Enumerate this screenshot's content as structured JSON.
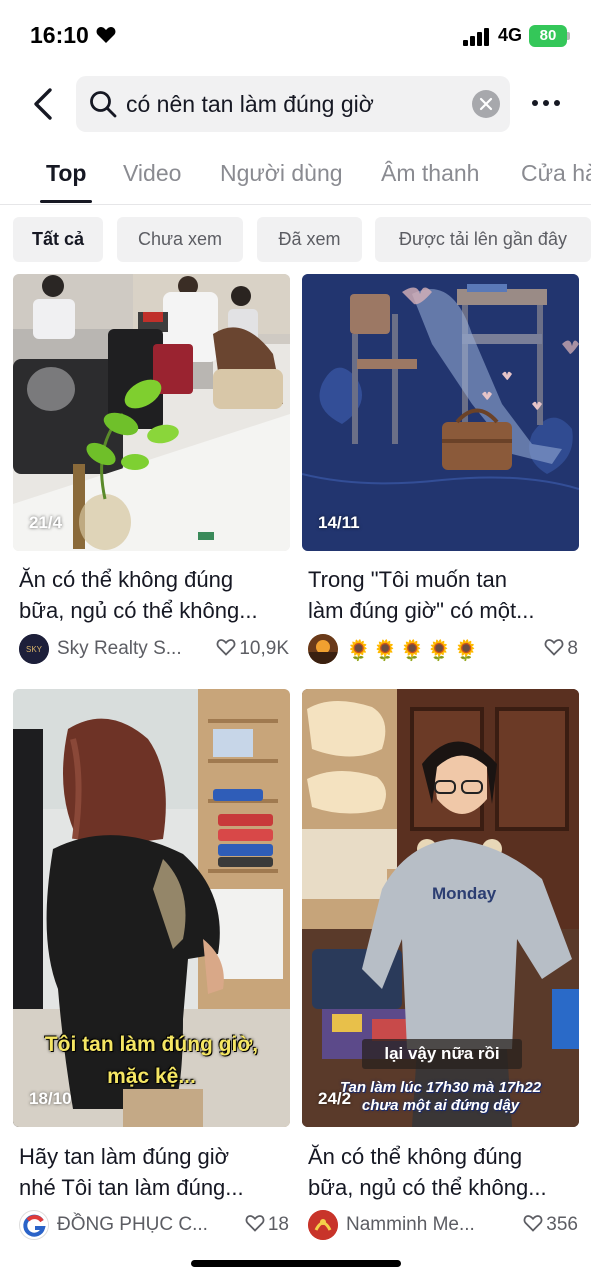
{
  "status": {
    "time": "16:10",
    "network": "4G",
    "battery": "80"
  },
  "search": {
    "query": "có nên tan làm đúng giờ"
  },
  "tabs": [
    "Top",
    "Video",
    "Người dùng",
    "Âm thanh",
    "Cửa hà"
  ],
  "filters": [
    "Tất cả",
    "Chưa xem",
    "Đã xem",
    "Được tải lên gần đây"
  ],
  "results": [
    {
      "date": "21/4",
      "caption_line1": "Ăn có thể không đúng",
      "caption_line2": "bữa, ngủ có thể không...",
      "author": "Sky Realty S...",
      "likes": "10,9K",
      "avatar_label": "SKY"
    },
    {
      "date": "14/11",
      "caption_line1": "Trong \"Tôi muốn tan",
      "caption_line2": "làm đúng giờ\" có một...",
      "author": "🌻🌻🌻🌻🌻",
      "likes": "8"
    },
    {
      "date": "18/10",
      "caption_line1": "Hãy tan làm đúng giờ",
      "caption_line2": "nhé Tôi tan làm đúng...",
      "author": "ĐỒNG PHỤC C...",
      "likes": "18",
      "overlay_line1": "Tôi tan làm đúng giờ,",
      "overlay_line2": "mặc kệ..."
    },
    {
      "date": "24/2",
      "caption_line1": "Ăn có thể không đúng",
      "caption_line2": "bữa, ngủ có thể không...",
      "author": "Namminh Me...",
      "likes": "356",
      "overlay_line1": "lại vậy nữa rồi",
      "overlay_line2": "Tan làm lúc 17h30 mà 17h22",
      "overlay_line3": "chưa một ai đứng dậy",
      "sweater_text": "Monday"
    }
  ],
  "colors": {
    "accent_text": "#161823",
    "muted_text": "#8a8b91",
    "chip_bg": "#f1f1f2",
    "battery": "#34c759",
    "overlay_yellow": "#f5e663"
  }
}
